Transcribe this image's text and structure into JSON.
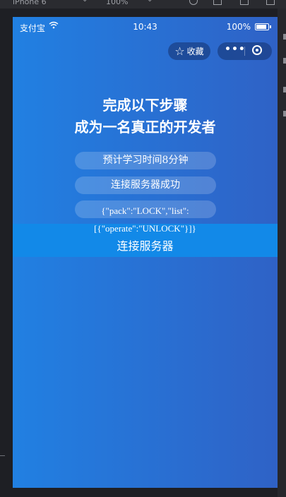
{
  "ide": {
    "device": "iPhone 6",
    "zoom": "100%"
  },
  "status_bar": {
    "carrier": "支付宝",
    "wifi_icon": "wifi-icon",
    "time": "10:43",
    "battery_percent": "100%"
  },
  "nav": {
    "favorite_label": "收藏",
    "favorite_icon": "star-icon",
    "more_icon": "more-icon",
    "close_icon": "close-circle-icon"
  },
  "main": {
    "title_line1": "完成以下步骤",
    "title_line2": "成为一名真正的开发者",
    "study_time": "预计学习时间8分钟",
    "connect_status": "连接服务器成功",
    "payload_line1": "{\"pack\":\"LOCK\",\"list\":",
    "payload_line2": "[{\"operate\":\"UNLOCK\"}]}",
    "connect_button": "连接服务器"
  },
  "colors": {
    "gradient_start": "#2180e2",
    "gradient_end": "#2f62c6",
    "button_bg": "#1289e8"
  }
}
